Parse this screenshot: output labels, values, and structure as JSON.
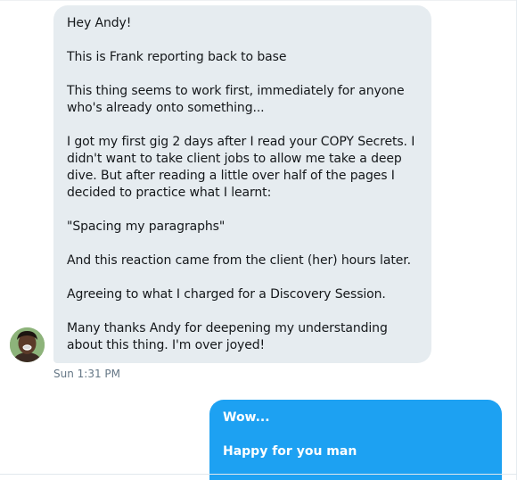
{
  "conversation": {
    "received_message": {
      "paragraphs": [
        "Hey Andy!",
        "This is Frank reporting back to base",
        "This thing seems to work first, immediately for anyone who's already onto something...",
        "I got my first gig 2 days after I read your COPY Secrets. I didn't want to take client jobs to allow me take a deep dive. But after reading a little over half of the pages I decided to practice what I learnt:",
        "\"Spacing my paragraphs\"",
        "And this reaction came from the client (her) hours later.",
        "Agreeing to what I charged for a Discovery Session.",
        "Many thanks Andy for deepening my understanding about this thing. I'm over joyed!"
      ],
      "timestamp": "Sun 1:31 PM",
      "bubble_color": "#e6ecf0"
    },
    "sent_message": {
      "paragraphs": [
        "Wow...",
        "Happy for you man"
      ],
      "bubble_color": "#1da1f2"
    },
    "avatar_icon": "user-avatar-photo"
  }
}
